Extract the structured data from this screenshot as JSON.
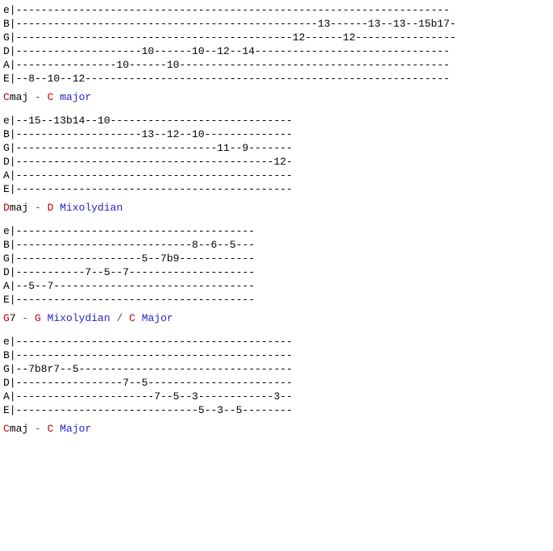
{
  "tab1": {
    "e": "e|---------------------------------------------------------------------",
    "B": "B|------------------------------------------------13------13--13--15b17-",
    "G": "G|--------------------------------------------12------12----------------",
    "D": "D|--------------------10------10--12--14-------------------------------",
    "A": "A|----------------10------10-------------------------------------------",
    "E": "E|--8--10--12----------------------------------------------------------"
  },
  "chord1": {
    "root": "C",
    "quality": "maj",
    "sep": " - ",
    "scale_root": "C",
    "scale_name": " major"
  },
  "tab2": {
    "e": "e|--15--13b14--10-----------------------------",
    "B": "B|--------------------13--12--10--------------",
    "G": "G|--------------------------------11--9-------",
    "D": "D|-----------------------------------------12-",
    "A": "A|--------------------------------------------",
    "E": "E|--------------------------------------------"
  },
  "chord2": {
    "root": "D",
    "quality": "maj",
    "sep": " - ",
    "scale_root": "D",
    "scale_name": " Mixolydian"
  },
  "tab3": {
    "e": "e|--------------------------------------",
    "B": "B|----------------------------8--6--5---",
    "G": "G|--------------------5--7b9------------",
    "D": "D|-----------7--5--7--------------------",
    "A": "A|--5--7--------------------------------",
    "E": "E|--------------------------------------"
  },
  "chord3": {
    "root": "G",
    "quality": "7",
    "sep": " - ",
    "scale_root": "G",
    "scale_name": " Mixolydian",
    "slash": " / ",
    "scale2_root": "C",
    "scale2_name": " Major"
  },
  "tab4": {
    "e": "e|--------------------------------------------",
    "B": "B|--------------------------------------------",
    "G": "G|--7b8r7--5----------------------------------",
    "D": "D|-----------------7--5-----------------------",
    "A": "A|----------------------7--5--3------------3--",
    "E": "E|-----------------------------5--3--5--------"
  },
  "chord4": {
    "root": "C",
    "quality": "maj",
    "sep": " - ",
    "scale_root": "C",
    "scale_name": " Major"
  }
}
